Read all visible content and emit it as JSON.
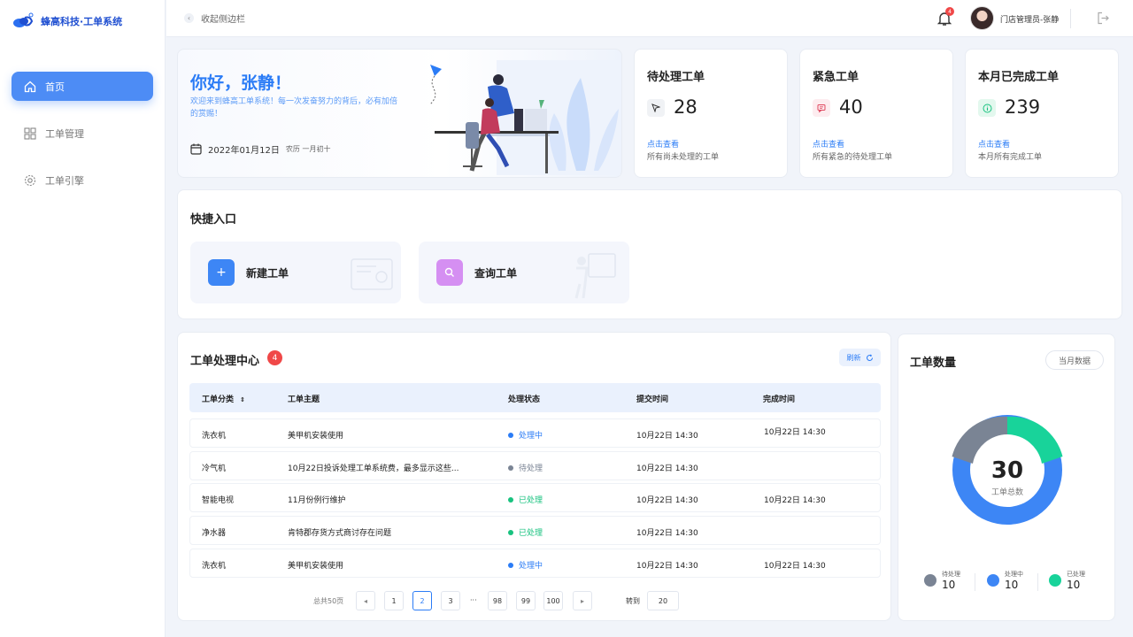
{
  "app": {
    "brand": "蜂高科技·工单系统"
  },
  "sidebar": {
    "items": [
      {
        "label": "首页",
        "icon": "home-icon",
        "active": true
      },
      {
        "label": "工单管理",
        "icon": "grid-icon",
        "active": false
      },
      {
        "label": "工单引擎",
        "icon": "gear-icon",
        "active": false
      }
    ]
  },
  "topbar": {
    "collapse_label": "收起侧边栏",
    "notification_count": "4",
    "username": "门店管理员-张静"
  },
  "welcome": {
    "greeting": "你好，张静！",
    "message": "欢迎来到蜂高工单系统！每一次发奋努力的背后，必有加倍的赏赐！",
    "date": "2022年01月12日",
    "lunar": "农历  一月初十"
  },
  "stats": [
    {
      "title": "待处理工单",
      "value": "28",
      "link": "点击查看",
      "desc": "所有尚未处理的工单",
      "icon": "cursor-icon",
      "color": "#f0f2f5"
    },
    {
      "title": "紧急工单",
      "value": "40",
      "link": "点击查看",
      "desc": "所有紧急的待处理工单",
      "icon": "message-icon",
      "color": "#fdecef"
    },
    {
      "title": "本月已完成工单",
      "value": "239",
      "link": "点击查看",
      "desc": "本月所有完成工单",
      "icon": "info-icon",
      "color": "#e3f8ee"
    }
  ],
  "quick": {
    "title": "快捷入口",
    "items": [
      {
        "label": "新建工单",
        "icon": "plus-icon",
        "color": "#3d86f5"
      },
      {
        "label": "查询工单",
        "icon": "search-icon",
        "color": "#d58ff2"
      }
    ]
  },
  "center": {
    "title": "工单处理中心",
    "badge": "4",
    "refresh": "刷新",
    "columns": [
      "工单分类",
      "工单主题",
      "处理状态",
      "提交时间",
      "完成时间"
    ],
    "rows": [
      {
        "category": "洗衣机",
        "subject": "美甲机安装使用",
        "status": "处理中",
        "status_color": "#2b7cf6",
        "submit": "10月22日  14:30",
        "done": "10月22日  14:30"
      },
      {
        "category": "冷气机",
        "subject": "10月22日投诉处理工单系统费，最多显示这些...",
        "status": "待处理",
        "status_color": "#7a8494",
        "submit": "10月22日  14:30",
        "done": ""
      },
      {
        "category": "智能电视",
        "subject": "11月份例行维护",
        "status": "已处理",
        "status_color": "#18c27f",
        "submit": "10月22日  14:30",
        "done": "10月22日  14:30"
      },
      {
        "category": "净水器",
        "subject": "肯特郡存货方式商讨存在问题",
        "status": "已处理",
        "status_color": "#18c27f",
        "submit": "10月22日  14:30",
        "done": ""
      },
      {
        "category": "洗衣机",
        "subject": "美甲机安装使用",
        "status": "处理中",
        "status_color": "#2b7cf6",
        "submit": "10月22日  14:30",
        "done": "10月22日  14:30"
      }
    ],
    "pager": {
      "total": "总共50页",
      "pages": [
        "1",
        "2",
        "3",
        "···",
        "98",
        "99",
        "100"
      ],
      "current": "2",
      "goto_label": "转到",
      "goto_value": "20"
    }
  },
  "count": {
    "title": "工单数量",
    "filter": "当月数据",
    "total": "30",
    "total_label": "工单总数",
    "legend": [
      {
        "label": "待处理",
        "value": "10",
        "color": "#7a8494"
      },
      {
        "label": "处理中",
        "value": "10",
        "color": "#3d86f5"
      },
      {
        "label": "已处理",
        "value": "10",
        "color": "#18d39a"
      }
    ]
  }
}
